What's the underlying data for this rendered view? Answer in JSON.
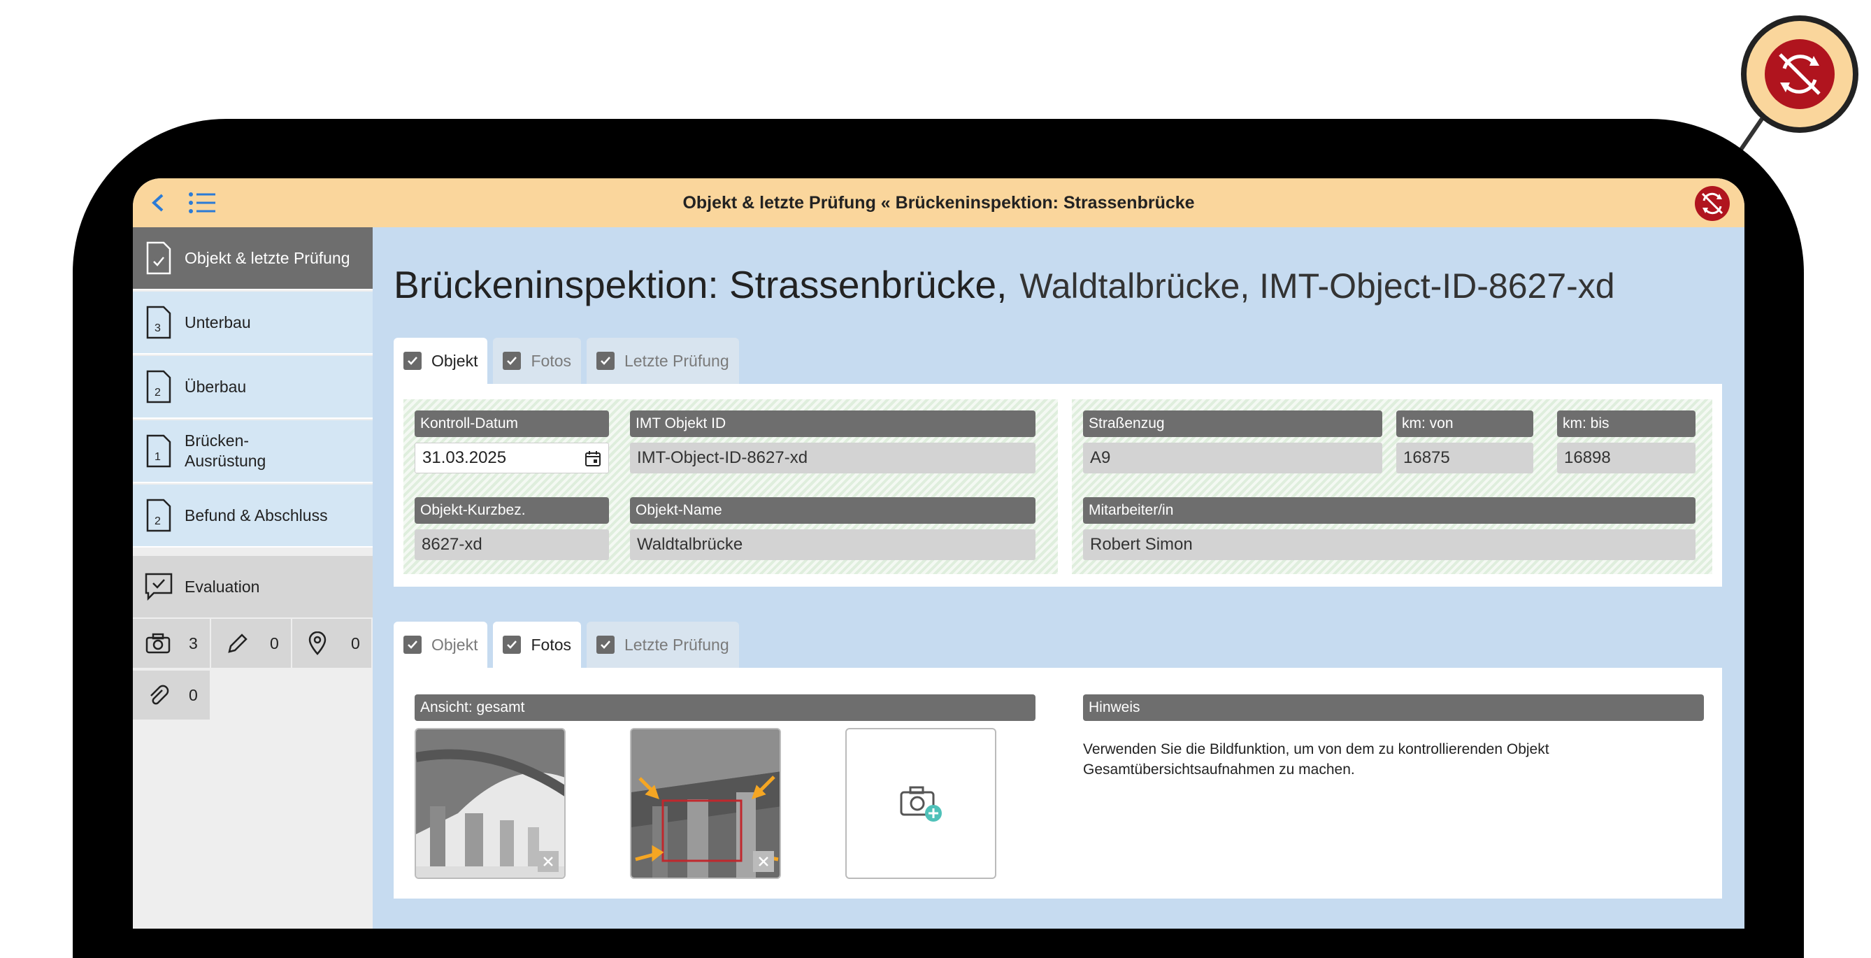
{
  "topbar": {
    "title": "Objekt & letzte Prüfung « Brückeninspektion: Strassenbrücke"
  },
  "sidebar": {
    "items": [
      {
        "label": "Objekt & letzte Prüfung",
        "count": ""
      },
      {
        "label": "Unterbau",
        "count": "3"
      },
      {
        "label": "Überbau",
        "count": "2"
      },
      {
        "label": "Brücken-\nAusrüstung",
        "count": "1"
      },
      {
        "label": "Befund & Abschluss",
        "count": "2"
      }
    ],
    "evaluation": {
      "label": "Evaluation"
    },
    "counters": {
      "photos": "3",
      "edits": "0",
      "locations": "0",
      "attachments": "0"
    }
  },
  "heading": {
    "title": "Brückeninspektion: Strassenbrücke,",
    "subtitle": "Waldtalbrücke, IMT-Object-ID-8627-xd"
  },
  "tabs1": [
    "Objekt",
    "Fotos",
    "Letzte Prüfung"
  ],
  "tabs2": [
    "Objekt",
    "Fotos",
    "Letzte Prüfung"
  ],
  "form": {
    "kontroll_datum": {
      "label": "Kontroll-Datum",
      "value": "31.03.2025"
    },
    "imt_objekt_id": {
      "label": "IMT Objekt ID",
      "value": "IMT-Object-ID-8627-xd"
    },
    "strassenzug": {
      "label": "Straßenzug",
      "value": "A9"
    },
    "km_von": {
      "label": "km: von",
      "value": "16875"
    },
    "km_bis": {
      "label": "km: bis",
      "value": "16898"
    },
    "kurzbez": {
      "label": "Objekt-Kurzbez.",
      "value": "8627-xd"
    },
    "objekt_name": {
      "label": "Objekt-Name",
      "value": "Waldtalbrücke"
    },
    "mitarbeiter": {
      "label": "Mitarbeiter/in",
      "value": "Robert Simon"
    }
  },
  "photos": {
    "section_label": "Ansicht: gesamt",
    "hint_label": "Hinweis",
    "hint_text": "Verwenden Sie die Bildfunktion, um von dem zu kontrollierenden Objekt Gesamtübersichtsaufnahmen zu machen."
  },
  "colors": {
    "topbar": "#fad69c",
    "screen": "#c6dbf0",
    "sync_red": "#b0141e",
    "accent_blue": "#2b7bd6"
  }
}
